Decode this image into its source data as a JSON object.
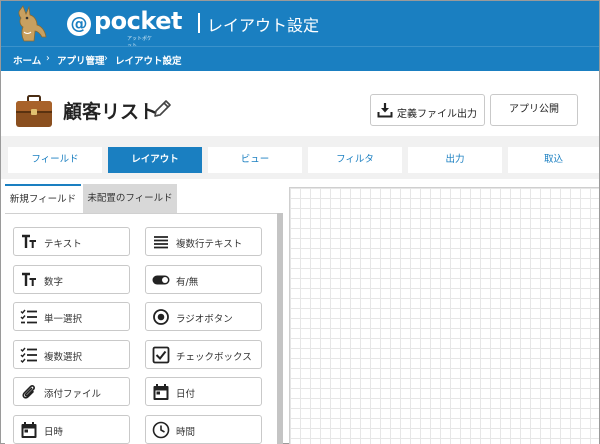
{
  "header": {
    "logo_at": "@",
    "logo_word": "pocket",
    "logo_sub": "アットポケット",
    "title": "レイアウト設定"
  },
  "breadcrumb": {
    "items": [
      "ホーム",
      "アプリ管理",
      "レイアウト設定"
    ],
    "separator": "›"
  },
  "app": {
    "name": "顧客リスト",
    "icon": "briefcase-icon"
  },
  "toolbar": {
    "export_label": "定義ファイル出力",
    "publish_label": "アプリ公開"
  },
  "tabs": [
    {
      "label": "フィールド",
      "active": false
    },
    {
      "label": "レイアウト",
      "active": true
    },
    {
      "label": "ビュー",
      "active": false
    },
    {
      "label": "フィルタ",
      "active": false
    },
    {
      "label": "出力",
      "active": false
    },
    {
      "label": "取込",
      "active": false
    }
  ],
  "panel": {
    "subtab_new": "新規フィールド",
    "subtab_unplaced": "未配置のフィールド"
  },
  "fields": [
    {
      "label": "テキスト",
      "icon": "text-icon"
    },
    {
      "label": "複数行テキスト",
      "icon": "multiline-text-icon"
    },
    {
      "label": "数字",
      "icon": "number-icon"
    },
    {
      "label": "有/無",
      "icon": "toggle-icon"
    },
    {
      "label": "単一選択",
      "icon": "single-select-icon"
    },
    {
      "label": "ラジオボタン",
      "icon": "radio-icon"
    },
    {
      "label": "複数選択",
      "icon": "multi-select-icon"
    },
    {
      "label": "チェックボックス",
      "icon": "checkbox-icon"
    },
    {
      "label": "添付ファイル",
      "icon": "paperclip-icon"
    },
    {
      "label": "日付",
      "icon": "calendar-icon"
    },
    {
      "label": "日時",
      "icon": "calendar-icon"
    },
    {
      "label": "時間",
      "icon": "clock-icon"
    }
  ],
  "colors": {
    "brand": "#1a7fc1",
    "tab_bar": "#f1f1f1"
  }
}
